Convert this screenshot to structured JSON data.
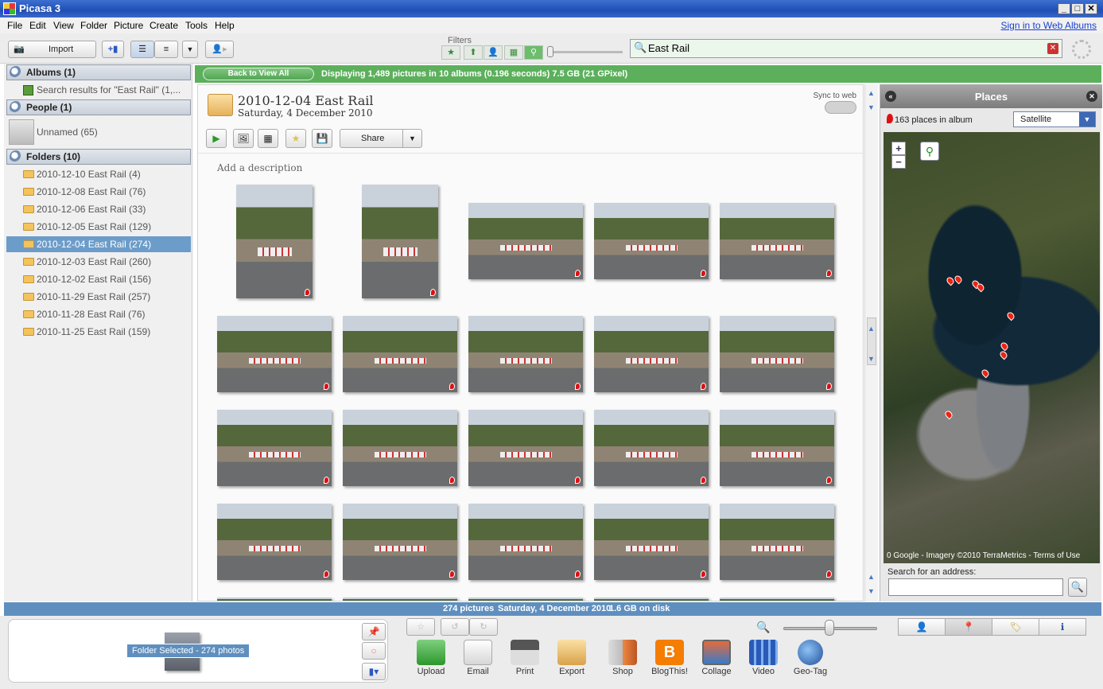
{
  "window": {
    "title": "Picasa 3"
  },
  "menu": [
    "File",
    "Edit",
    "View",
    "Folder",
    "Picture",
    "Create",
    "Tools",
    "Help"
  ],
  "signin_link": "Sign in to Web Albums",
  "toolbar": {
    "import_label": "Import",
    "filters_label": "Filters"
  },
  "search": {
    "value": "East Rail"
  },
  "left_panel": {
    "albums_header": "Albums (1)",
    "albums": [
      "Search results for \"East Rail\" (1,..."
    ],
    "people_header": "People (1)",
    "people": [
      "Unnamed (65)"
    ],
    "folders_header": "Folders (10)",
    "folders": [
      "2010-12-10 East Rail (4)",
      "2010-12-08 East Rail (76)",
      "2010-12-06 East Rail (33)",
      "2010-12-05 East Rail (129)",
      "2010-12-04 East Rail (274)",
      "2010-12-03 East Rail (260)",
      "2010-12-02 East Rail (156)",
      "2010-11-29 East Rail (257)",
      "2010-11-28 East Rail (76)",
      "2010-11-25 East Rail (159)"
    ],
    "selected_folder_index": 4
  },
  "banner": {
    "back_label": "Back to View All",
    "text": "Displaying 1,489 pictures in 10 albums (0.196 seconds) 7.5 GB (21 GPixel)"
  },
  "album": {
    "title": "2010-12-04 East Rail",
    "date": "Saturday, 4 December 2010",
    "sync_label": "Sync to web",
    "share_label": "Share",
    "description_placeholder": "Add a description"
  },
  "places": {
    "title": "Places",
    "count": "163 places in album",
    "map_type": "Satellite",
    "credit": "0 Google - Imagery ©2010 TerraMetrics - Terms of Use",
    "address_label": "Search for an address:"
  },
  "status": {
    "pictures": "274 pictures",
    "date": "Saturday, 4 December 2010",
    "disk": "1.6 GB on disk"
  },
  "tray": {
    "label": "Folder Selected - 274 photos"
  },
  "actions": [
    "Upload",
    "Email",
    "Print",
    "Export",
    "Shop",
    "BlogThis!",
    "Collage",
    "Video",
    "Geo-Tag"
  ],
  "colors": {
    "banner": "#5cb05c",
    "selection": "#6c9cc9",
    "status": "#5f8fbf"
  }
}
